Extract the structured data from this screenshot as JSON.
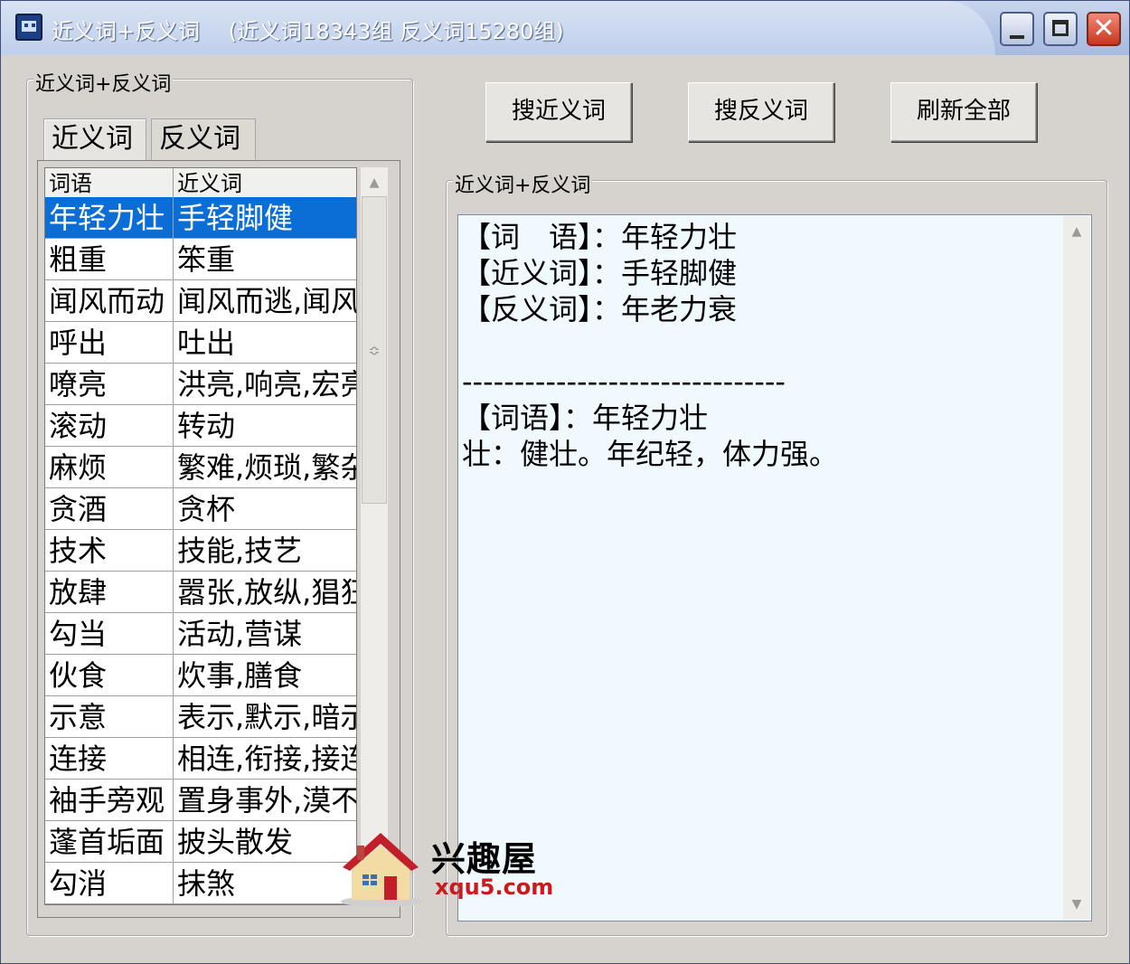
{
  "window": {
    "title": "近义词+反义词　 (近义词18343组 反义词15280组)",
    "min_icon": "minimize-icon",
    "max_icon": "maximize-icon",
    "close_glyph": "✕"
  },
  "left_group": {
    "label": "近义词+反义词",
    "tabs": [
      {
        "label": "近义词",
        "active": true
      },
      {
        "label": "反义词",
        "active": false
      }
    ],
    "columns": [
      "词语",
      "近义词"
    ],
    "rows": [
      [
        "年轻力壮",
        "手轻脚健"
      ],
      [
        "粗重",
        "笨重"
      ],
      [
        "闻风而动",
        "闻风而逃,闻风"
      ],
      [
        "呼出",
        "吐出"
      ],
      [
        "嘹亮",
        "洪亮,响亮,宏亮"
      ],
      [
        "滚动",
        "转动"
      ],
      [
        "麻烦",
        "繁难,烦琐,繁杂"
      ],
      [
        "贪酒",
        "贪杯"
      ],
      [
        "技术",
        "技能,技艺"
      ],
      [
        "放肆",
        "嚣张,放纵,猖狂"
      ],
      [
        "勾当",
        "活动,营谋"
      ],
      [
        "伙食",
        "炊事,膳食"
      ],
      [
        "示意",
        "表示,默示,暗示"
      ],
      [
        "连接",
        "相连,衔接,接连"
      ],
      [
        "袖手旁观",
        "置身事外,漠不"
      ],
      [
        "蓬首垢面",
        "披头散发"
      ],
      [
        "勾消",
        "抹煞"
      ]
    ],
    "selected_index": 0
  },
  "toolbar": {
    "search_synonym": "搜近义词",
    "search_antonym": "搜反义词",
    "refresh_all": "刷新全部"
  },
  "right_group": {
    "label": "近义词+反义词",
    "content": "【词　语】：年轻力壮\n【近义词】：手轻脚健\n【反义词】：年老力衰\n\n-------------------------------\n【词语】：年轻力壮\n壮：健壮。年纪轻，体力强。"
  },
  "watermark": {
    "title": "兴趣屋",
    "url": "xqu5.com"
  },
  "colors": {
    "selection": "#0a6ed6",
    "text_bg": "#f0fafe",
    "window_bg": "#d6d3ce"
  }
}
